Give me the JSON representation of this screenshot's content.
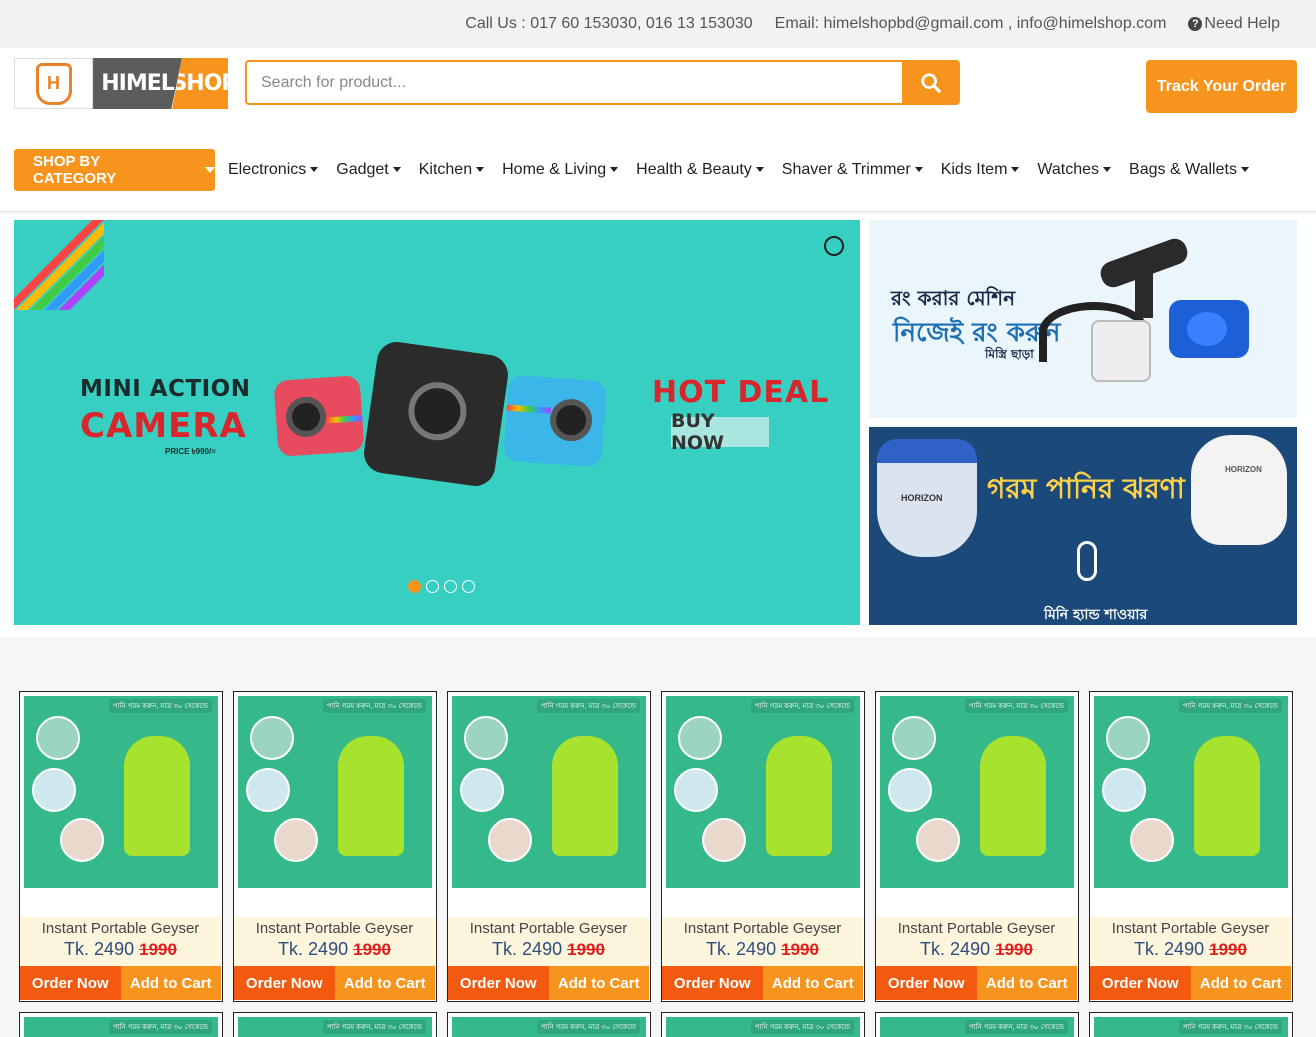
{
  "topbar": {
    "call": "Call Us : 017 60 153030, 016 13 153030",
    "email": "Email: himelshopbd@gmail.com , info@himelshop.com",
    "help": "Need Help"
  },
  "header": {
    "logo_left": "HIMEL",
    "logo_right": "SHOP",
    "search_placeholder": "Search for product...",
    "track_label": "Track Your Order"
  },
  "nav": {
    "category_button": "SHOP BY CATEGORY",
    "items": [
      {
        "label": "Electronics"
      },
      {
        "label": "Gadget"
      },
      {
        "label": "Kitchen"
      },
      {
        "label": "Home & Living"
      },
      {
        "label": "Health & Beauty"
      },
      {
        "label": "Shaver & Trimmer"
      },
      {
        "label": "Kids Item"
      },
      {
        "label": "Watches"
      },
      {
        "label": "Bags & Wallets"
      }
    ]
  },
  "slider": {
    "title_line1": "MINI ACTION",
    "title_line2": "CAMERA",
    "price_note": "PRICE ৳990/=",
    "hot_deal": "HOT DEAL",
    "buy_now": "BUY NOW",
    "slides": 4,
    "active_slide": 1
  },
  "side_banners": {
    "banner1_line1": "রং করার মেশিন",
    "banner1_line2": "নিজেই রং করুন",
    "banner1_line3": "মিস্ত্রি ছাড়া",
    "banner2_title": "গরম পানির ঝরণা",
    "banner2_sub": "মিনি হ্যান্ড শাওয়ার",
    "banner2_brand": "HORIZON"
  },
  "products": [
    {
      "name": "Instant Portable Geyser",
      "price": "Tk. 2490",
      "old_price": "1990",
      "tag": "পানি গরম করুন, মাত্র ৩০ সেকেন্ডে",
      "order": "Order Now",
      "cart": "Add to Cart"
    },
    {
      "name": "Instant Portable Geyser",
      "price": "Tk. 2490",
      "old_price": "1990",
      "tag": "পানি গরম করুন, মাত্র ৩০ সেকেন্ডে",
      "order": "Order Now",
      "cart": "Add to Cart"
    },
    {
      "name": "Instant Portable Geyser",
      "price": "Tk. 2490",
      "old_price": "1990",
      "tag": "পানি গরম করুন, মাত্র ৩০ সেকেন্ডে",
      "order": "Order Now",
      "cart": "Add to Cart"
    },
    {
      "name": "Instant Portable Geyser",
      "price": "Tk. 2490",
      "old_price": "1990",
      "tag": "পানি গরম করুন, মাত্র ৩০ সেকেন্ডে",
      "order": "Order Now",
      "cart": "Add to Cart"
    },
    {
      "name": "Instant Portable Geyser",
      "price": "Tk. 2490",
      "old_price": "1990",
      "tag": "পানি গরম করুন, মাত্র ৩০ সেকেন্ডে",
      "order": "Order Now",
      "cart": "Add to Cart"
    },
    {
      "name": "Instant Portable Geyser",
      "price": "Tk. 2490",
      "old_price": "1990",
      "tag": "পানি গরম করুন, মাত্র ৩০ সেকেন্ডে",
      "order": "Order Now",
      "cart": "Add to Cart"
    }
  ],
  "colors": {
    "accent": "#f7941d",
    "order_button": "#f15a0f",
    "slider_bg": "#37cfc1",
    "product_bg": "#35b98a",
    "old_price": "#e21b1b"
  }
}
